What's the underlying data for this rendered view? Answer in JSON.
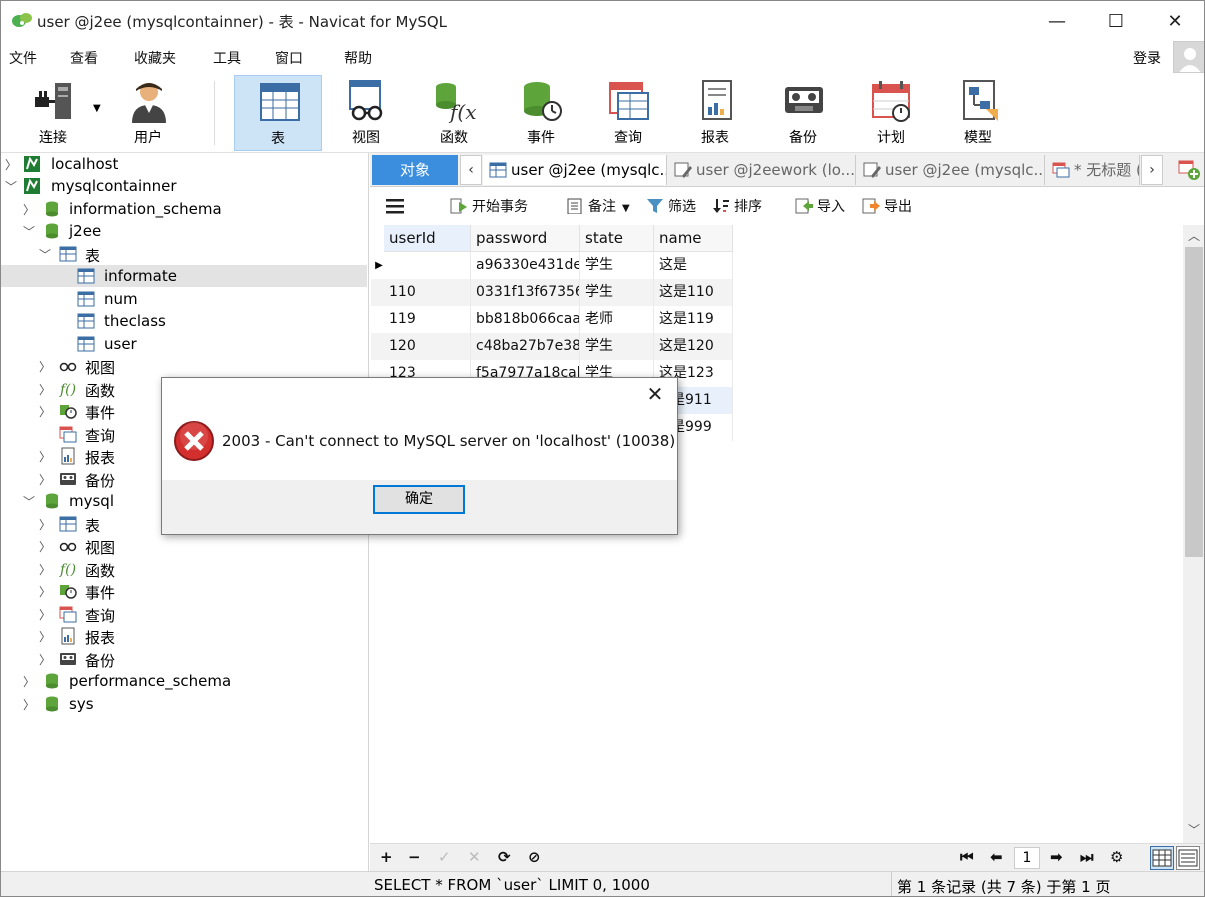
{
  "window": {
    "title": "user @j2ee (mysqlcontainner) - 表 - Navicat for MySQL",
    "minimize": "—",
    "maximize": "☐",
    "close": "✕"
  },
  "menu": {
    "items": [
      "文件",
      "查看",
      "收藏夹",
      "工具",
      "窗口",
      "帮助"
    ],
    "login": "登录"
  },
  "toolbar": {
    "buttons": [
      {
        "label": "连接",
        "icon": "plug-icon"
      },
      {
        "label": "用户",
        "icon": "user-icon"
      },
      {
        "label": "表",
        "icon": "table-icon"
      },
      {
        "label": "视图",
        "icon": "view-glasses-icon"
      },
      {
        "label": "函数",
        "icon": "function-icon"
      },
      {
        "label": "事件",
        "icon": "event-clock-icon"
      },
      {
        "label": "查询",
        "icon": "query-icon"
      },
      {
        "label": "报表",
        "icon": "report-icon"
      },
      {
        "label": "备份",
        "icon": "backup-tape-icon"
      },
      {
        "label": "计划",
        "icon": "calendar-icon"
      },
      {
        "label": "模型",
        "icon": "model-icon"
      }
    ]
  },
  "tree": {
    "nodes": [
      {
        "label": "localhost"
      },
      {
        "label": "mysqlcontainner"
      },
      {
        "label": "information_schema"
      },
      {
        "label": "j2ee"
      },
      {
        "label": "表"
      },
      {
        "label": "informate"
      },
      {
        "label": "num"
      },
      {
        "label": "theclass"
      },
      {
        "label": "user"
      },
      {
        "label": "视图"
      },
      {
        "label": "函数"
      },
      {
        "label": "事件"
      },
      {
        "label": "查询"
      },
      {
        "label": "报表"
      },
      {
        "label": "备份"
      },
      {
        "label": "mysql"
      },
      {
        "label": "表"
      },
      {
        "label": "视图"
      },
      {
        "label": "函数"
      },
      {
        "label": "事件"
      },
      {
        "label": "查询"
      },
      {
        "label": "报表"
      },
      {
        "label": "备份"
      },
      {
        "label": "performance_schema"
      },
      {
        "label": "sys"
      }
    ]
  },
  "tabs": {
    "objects": "对象",
    "items": [
      "user @j2ee (mysqlc...",
      "user @j2eework (lo...",
      "user @j2ee (mysqlc...",
      "* 无标题 ("
    ]
  },
  "gridToolbar": {
    "begin_tx": "开始事务",
    "memo": "备注",
    "filter": "筛选",
    "sort": "排序",
    "import": "导入",
    "export": "导出"
  },
  "grid": {
    "columns": [
      "userId",
      "password",
      "state",
      "name"
    ],
    "rows": [
      [
        "",
        "a96330e431de",
        "学生",
        "这是"
      ],
      [
        "110",
        "0331f13f67356",
        "学生",
        "这是110"
      ],
      [
        "119",
        "bb818b066caa",
        "老师",
        "这是119"
      ],
      [
        "120",
        "c48ba27b7e38",
        "学生",
        "这是120"
      ],
      [
        "123",
        "f5a7977a18cab",
        "学生",
        "这是123"
      ],
      [
        "",
        "",
        "",
        "是911"
      ],
      [
        "",
        "",
        "",
        "是999"
      ]
    ]
  },
  "navbar": {
    "add": "+",
    "remove": "−",
    "apply": "✓",
    "discard": "✕",
    "refresh": "⟳",
    "stop": "⊘",
    "first": "⏮",
    "prev": "⬅",
    "page": "1",
    "next": "➡",
    "last": "⏭",
    "settings": "⚙"
  },
  "status": {
    "sql": "SELECT * FROM `user` LIMIT 0, 1000",
    "records": "第 1 条记录 (共 7 条) 于第 1 页"
  },
  "dialog": {
    "message": "2003 - Can't connect to MySQL server on 'localhost' (10038)",
    "ok": "确定",
    "close": "✕"
  }
}
